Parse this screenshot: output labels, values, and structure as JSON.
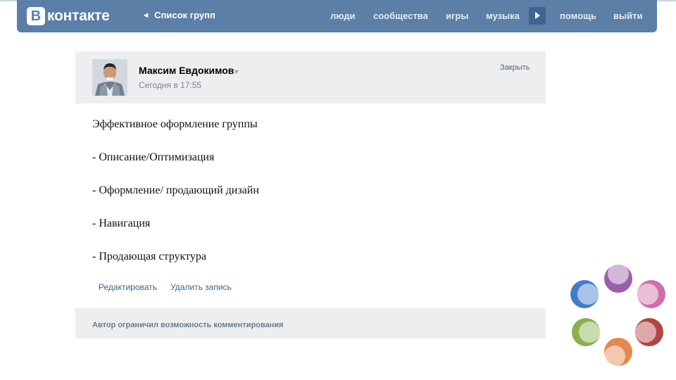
{
  "header": {
    "logo_letter": "В",
    "logo_text": "контакте",
    "back_link": "Список групп",
    "nav": [
      {
        "label": "люди"
      },
      {
        "label": "сообщества"
      },
      {
        "label": "игры"
      },
      {
        "label": "музыка"
      },
      {
        "label": "помощь"
      },
      {
        "label": "выйти"
      }
    ],
    "brand_color": "#5b7fa6"
  },
  "post": {
    "author": "Максим Евдокимов",
    "author_menu_arrow": "▾",
    "time": "Сегодня в 17:55",
    "close_label": "Закрыть",
    "lines": [
      "Эффективное оформление группы",
      "- Описание/Оптимизация",
      "- Оформление/ продающий дизайн",
      "- Навигация",
      "- Продающая структура"
    ],
    "actions": {
      "edit": "Редактировать",
      "delete": "Удалить запись"
    },
    "comments_notice": "Автор ограничил возможность комментирования"
  },
  "decoration": {
    "ring_colors": [
      "#8e4fa0",
      "#c95fa3",
      "#a8302f",
      "#e07b3c",
      "#7aa83a",
      "#2f6fc4"
    ]
  }
}
